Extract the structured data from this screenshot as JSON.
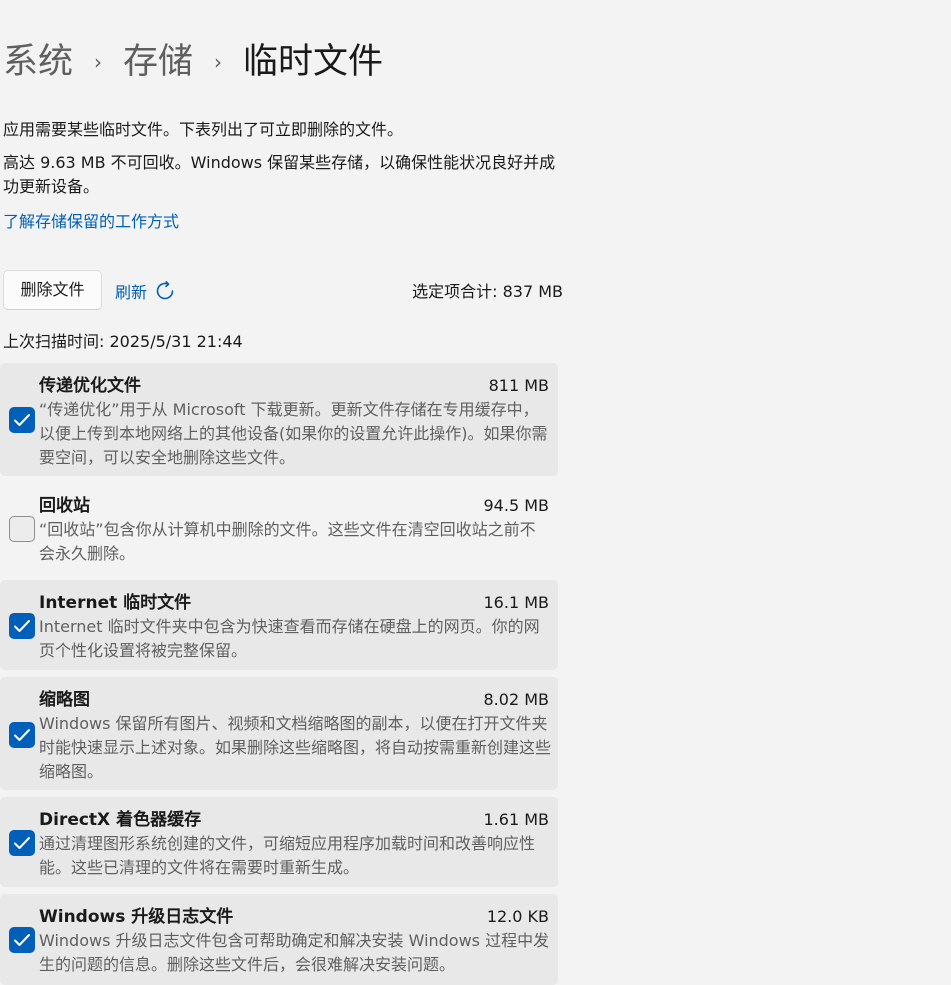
{
  "breadcrumb": {
    "items": [
      "系统",
      "存储"
    ],
    "current": "临时文件",
    "separator": "›"
  },
  "description": {
    "line1": "应用需要某些临时文件。下表列出了可立即删除的文件。",
    "line2": "高达 9.63 MB 不可回收。Windows 保留某些存储，以确保性能状况良好并成功更新设备。"
  },
  "learn_link": "了解存储保留的工作方式",
  "toolbar": {
    "delete_label": "删除文件",
    "refresh_label": "刷新",
    "total_label": "选定项合计: 837 MB"
  },
  "scan_time": "上次扫描时间: 2025/5/31 21:44",
  "items": [
    {
      "title": "传递优化文件",
      "size": "811 MB",
      "checked": true,
      "description": "“传递优化”用于从 Microsoft 下载更新。更新文件存储在专用缓存中，以便上传到本地网络上的其他设备(如果你的设置允许此操作)。如果你需要空间，可以安全地删除这些文件。"
    },
    {
      "title": "回收站",
      "size": "94.5 MB",
      "checked": false,
      "description": "“回收站”包含你从计算机中删除的文件。这些文件在清空回收站之前不会永久删除。"
    },
    {
      "title": "Internet 临时文件",
      "size": "16.1 MB",
      "checked": true,
      "description": "Internet 临时文件夹中包含为快速查看而存储在硬盘上的网页。你的网页个性化设置将被完整保留。"
    },
    {
      "title": "缩略图",
      "size": "8.02 MB",
      "checked": true,
      "description": "Windows 保留所有图片、视频和文档缩略图的副本，以便在打开文件夹时能快速显示上述对象。如果删除这些缩略图，将自动按需重新创建这些缩略图。"
    },
    {
      "title": "DirectX 着色器缓存",
      "size": "1.61 MB",
      "checked": true,
      "description": "通过清理图形系统创建的文件，可缩短应用程序加载时间和改善响应性能。这些已清理的文件将在需要时重新生成。"
    },
    {
      "title": "Windows 升级日志文件",
      "size": "12.0 KB",
      "checked": true,
      "description": "Windows 升级日志文件包含可帮助确定和解决安装 Windows 过程中发生的问题的信息。删除这些文件后，会很难解决安装问题。"
    }
  ],
  "colors": {
    "accent": "#005fb8",
    "background": "#f3f3f3",
    "card_checked": "#e8e8e8"
  },
  "icons": {
    "refresh": "refresh-icon",
    "checkbox": "checkmark-icon",
    "breadcrumb_separator": "chevron-right-icon"
  }
}
